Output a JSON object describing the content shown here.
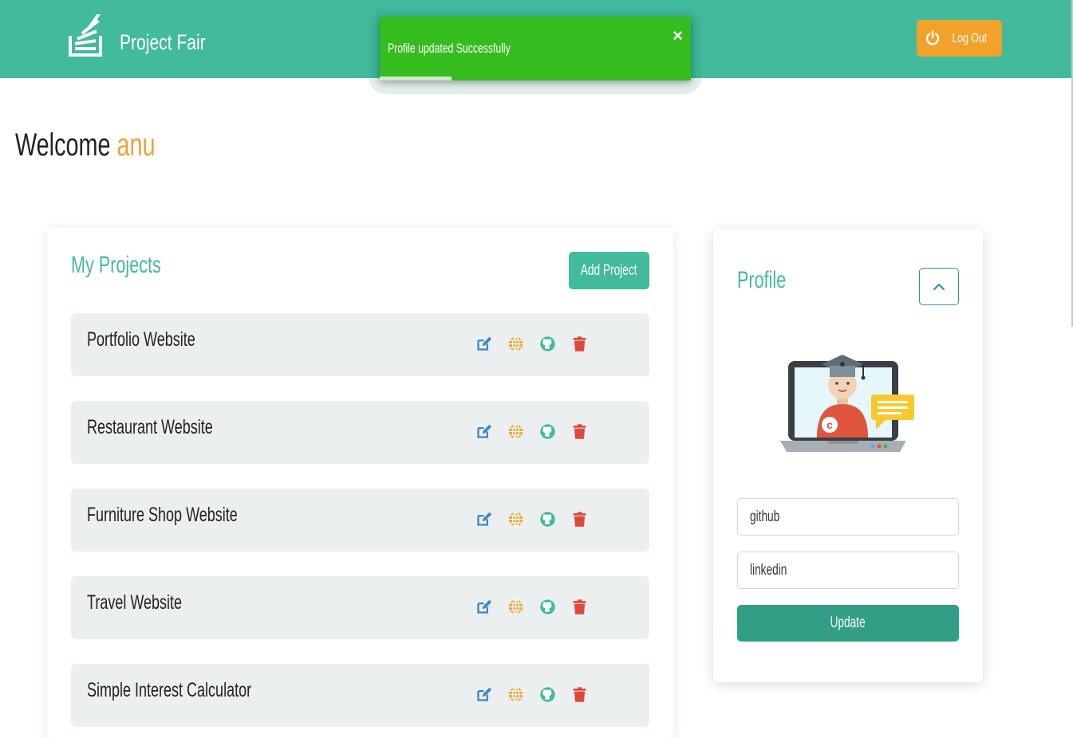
{
  "header": {
    "brand_name": "Project Fair",
    "logout_label": "Log Out",
    "logo_icon": "stack-logo-icon",
    "logout_icon": "power-icon"
  },
  "toast": {
    "message": "Profile updated Successfully",
    "close_icon": "close-icon",
    "progress_fraction": 0.23
  },
  "welcome": {
    "greeting": "Welcome",
    "username": "anu"
  },
  "projects": {
    "title": "My Projects",
    "add_label": "Add Project",
    "items": [
      {
        "name": "Portfolio Website"
      },
      {
        "name": "Restaurant Website"
      },
      {
        "name": "Furniture Shop Website"
      },
      {
        "name": "Travel Website"
      },
      {
        "name": "Simple Interest Calculator"
      }
    ],
    "action_icons": [
      "edit-icon",
      "globe-icon",
      "github-icon",
      "trash-icon"
    ]
  },
  "profile": {
    "title": "Profile",
    "collapse_icon": "chevron-up-icon",
    "github_value": "github",
    "linkedin_value": "linkedin",
    "update_label": "Update"
  },
  "colors": {
    "primary": "#41bb9b",
    "accent": "#f2a12b",
    "toast": "#35bd1f",
    "update": "#329e85",
    "edit": "#3a86c8",
    "globe": "#e9a33b",
    "github": "#41bb9b",
    "trash": "#e0483a"
  }
}
